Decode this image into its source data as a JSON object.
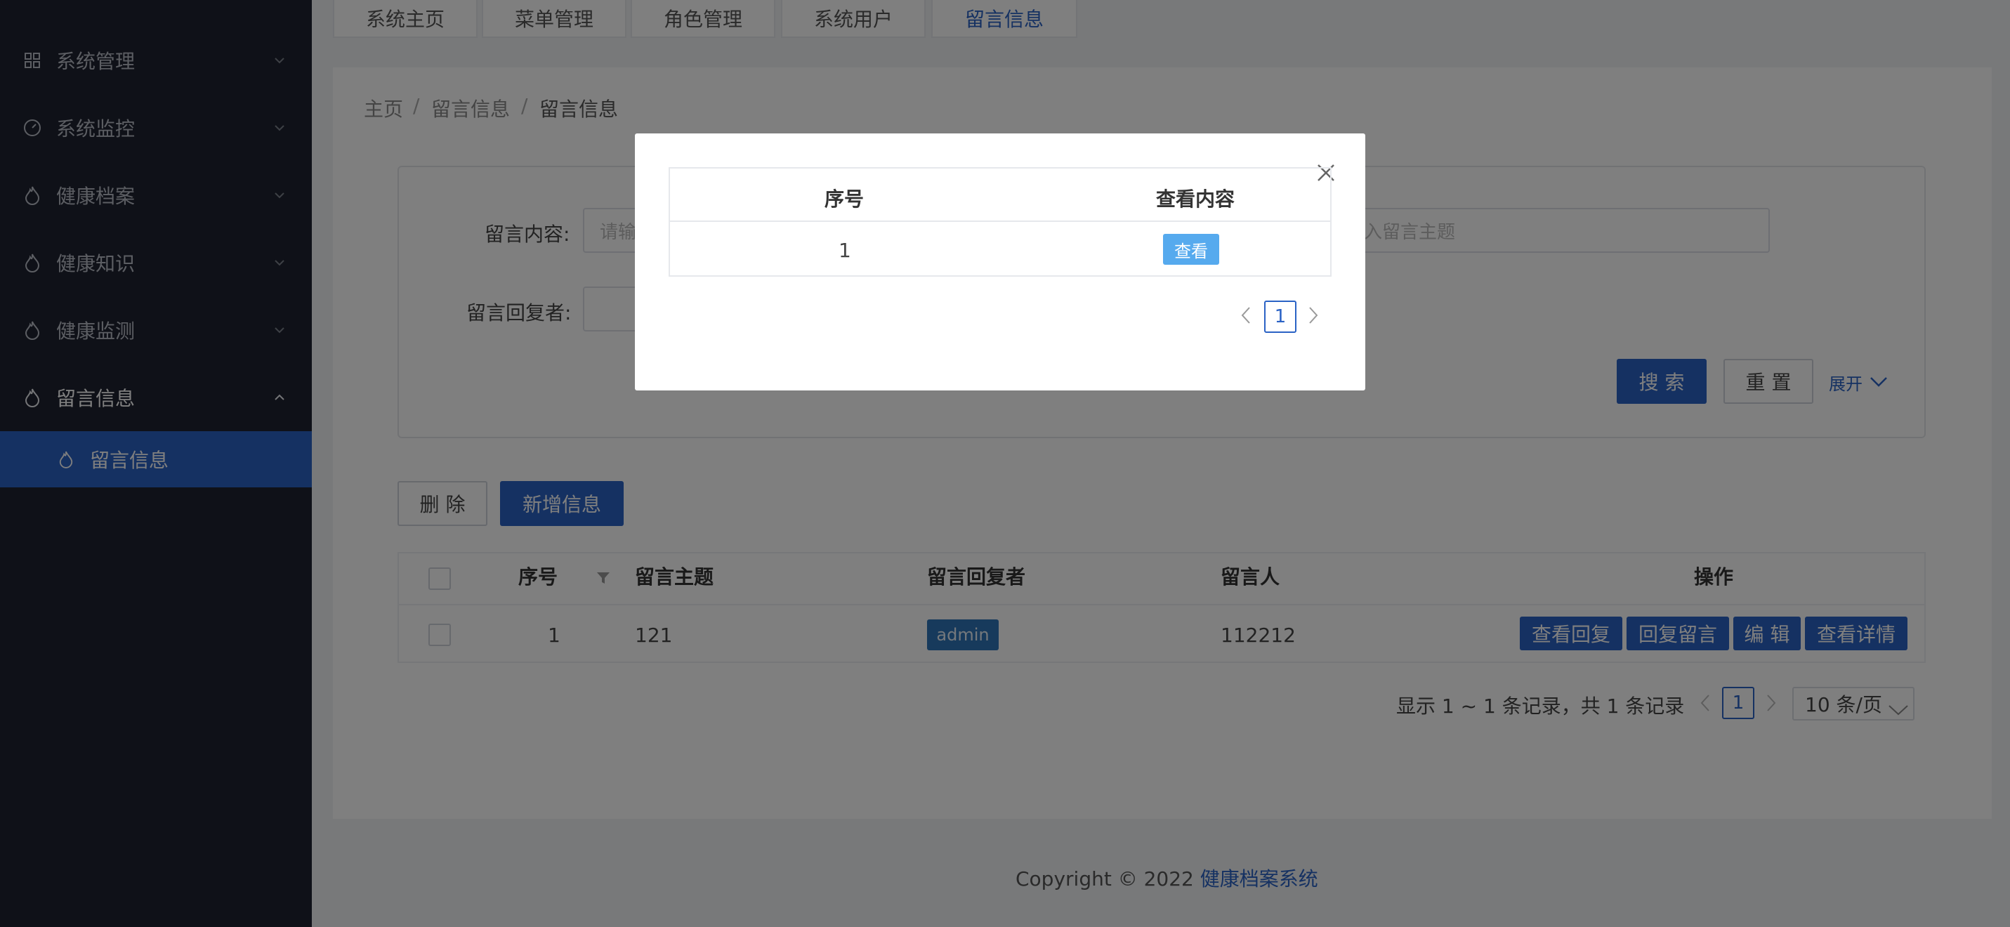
{
  "sidebar": {
    "items": [
      {
        "label": "系统管理",
        "icon": "grid-icon"
      },
      {
        "label": "系统监控",
        "icon": "gauge-icon"
      },
      {
        "label": "健康档案",
        "icon": "drop-icon"
      },
      {
        "label": "健康知识",
        "icon": "drop-icon"
      },
      {
        "label": "健康监测",
        "icon": "drop-icon"
      },
      {
        "label": "留言信息",
        "icon": "drop-icon"
      }
    ],
    "sub_item": {
      "label": "留言信息"
    }
  },
  "tabs": [
    {
      "label": "系统主页"
    },
    {
      "label": "菜单管理"
    },
    {
      "label": "角色管理"
    },
    {
      "label": "系统用户"
    },
    {
      "label": "留言信息"
    }
  ],
  "breadcrumb": {
    "home": "主页",
    "section": "留言信息",
    "current": "留言信息",
    "sep": "/"
  },
  "search": {
    "content_label": "留言内容:",
    "content_placeholder": "请输入留言内容",
    "topic_placeholder": "请输入留言主题",
    "replier_label": "留言回复者:",
    "search_btn": "搜 索",
    "reset_btn": "重 置",
    "expand_link": "展开"
  },
  "toolbar": {
    "delete_btn": "删 除",
    "add_btn": "新增信息"
  },
  "table": {
    "headers": {
      "index": "序号",
      "topic": "留言主题",
      "replier": "留言回复者",
      "author": "留言人",
      "actions": "操作"
    },
    "rows": [
      {
        "index": "1",
        "topic": "121",
        "replier": "admin",
        "author": "112212"
      }
    ],
    "row_actions": [
      "查看回复",
      "回复留言",
      "编 辑",
      "查看详情"
    ]
  },
  "pagination": {
    "summary": "显示 1 ~ 1 条记录，共 1 条记录",
    "page": "1",
    "page_size": "10 条/页"
  },
  "footer": {
    "copyright": "Copyright © 2022 ",
    "brand": "健康档案系统"
  },
  "modal": {
    "headers": {
      "index": "序号",
      "content": "查看内容"
    },
    "rows": [
      {
        "index": "1",
        "action": "查看"
      }
    ],
    "page": "1"
  }
}
